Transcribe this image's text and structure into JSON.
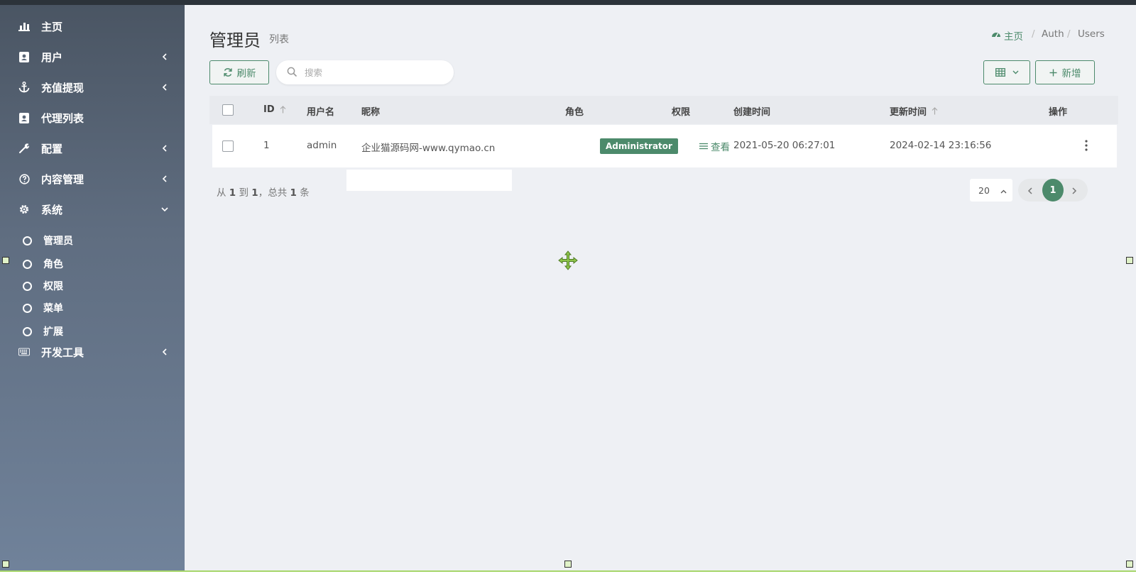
{
  "sidebar": {
    "items": [
      {
        "label": "主页",
        "icon": "bar-chart-icon"
      },
      {
        "label": "用户",
        "icon": "user-card-icon"
      },
      {
        "label": "充值提现",
        "icon": "anchor-icon"
      },
      {
        "label": "代理列表",
        "icon": "user-card-icon"
      },
      {
        "label": "配置",
        "icon": "wrench-icon"
      },
      {
        "label": "内容管理",
        "icon": "question-circle-icon"
      },
      {
        "label": "系统",
        "icon": "gear-icon"
      },
      {
        "label": "开发工具",
        "icon": "keyboard-icon"
      }
    ],
    "sub_items": [
      {
        "label": "管理员"
      },
      {
        "label": "角色"
      },
      {
        "label": "权限"
      },
      {
        "label": "菜单"
      },
      {
        "label": "扩展"
      }
    ]
  },
  "header": {
    "title": "管理员",
    "subtitle": "列表"
  },
  "breadcrumb": {
    "home": "主页",
    "items": [
      "Auth",
      "Users"
    ],
    "separator": "/"
  },
  "toolbar": {
    "refresh_label": "刷新",
    "search_placeholder": "搜索",
    "add_label": "新增"
  },
  "table": {
    "columns": [
      "ID",
      "用户名",
      "昵称",
      "角色",
      "权限",
      "创建时间",
      "更新时间",
      "操作"
    ],
    "rows": [
      {
        "id": "1",
        "username": "admin",
        "nickname": "企业猫源码网-www.qymao.cn",
        "role": "Administrator",
        "permission": "查看",
        "created_at": "2021-05-20 06:27:01",
        "updated_at": "2024-02-14 23:16:56"
      }
    ]
  },
  "pagination": {
    "info_from_label": "从",
    "from": "1",
    "to_label": "到",
    "to": "1",
    "total_label": "，总共",
    "total": "1",
    "unit": "条",
    "per_page": "20",
    "current_page": "1"
  },
  "colors": {
    "accent": "#4c8a6b",
    "sidebar_top": "#4a5563",
    "sidebar_bottom": "#70829a",
    "background": "#eef0f4"
  }
}
